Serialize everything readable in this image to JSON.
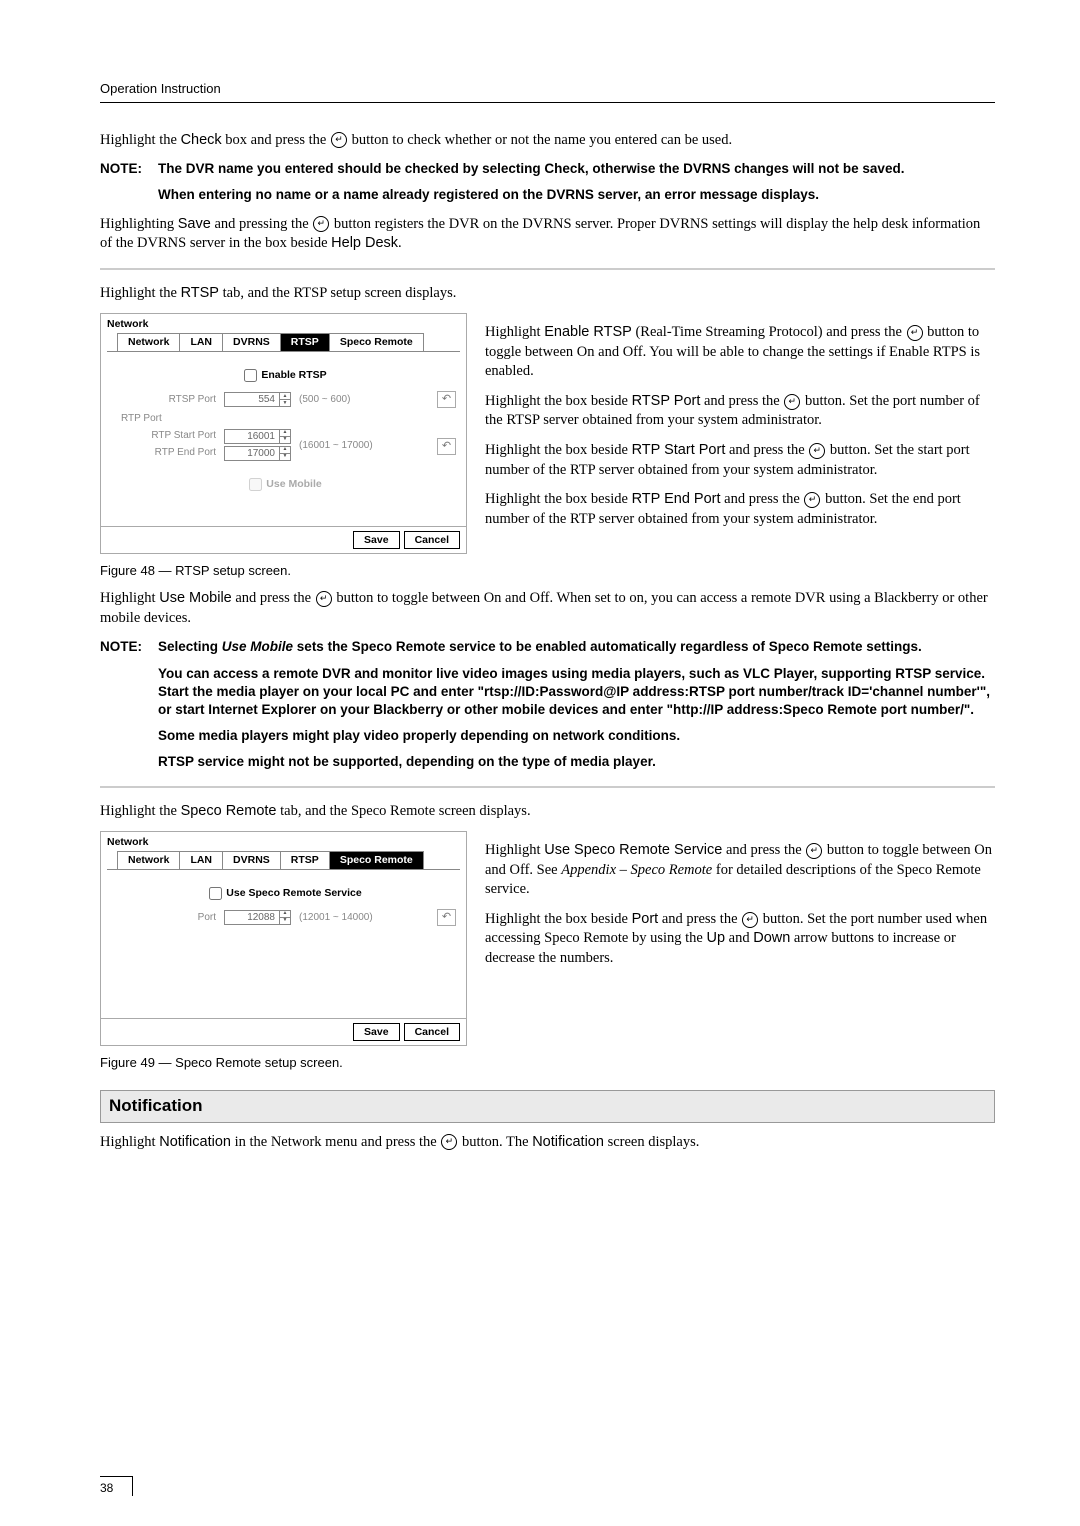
{
  "header": "Operation Instruction",
  "p1_a": "Highlight the ",
  "p1_b": "Check",
  "p1_c": " box and press the ",
  "p1_d": " button to check whether or not the name you entered can be used.",
  "note1_label": "NOTE:",
  "note1_text": "The DVR name you entered should be checked by selecting Check, otherwise the DVRNS changes will not be saved.",
  "note1b": "When entering no name or a name already registered on the DVRNS server, an error message displays.",
  "p2_a": "Highlighting ",
  "p2_b": "Save",
  "p2_c": " and pressing the ",
  "p2_d": " button registers the DVR on the DVRNS server.  Proper DVRNS settings will display the help desk information of the DVRNS server in the box beside ",
  "p2_e": "Help Desk",
  "p2_f": ".",
  "p3_a": "Highlight the ",
  "p3_b": "RTSP",
  "p3_c": " tab, and the RTSP setup screen displays.",
  "panel1": {
    "title": "Network",
    "tabs": {
      "network": "Network",
      "lan": "LAN",
      "dvrns": "DVRNS",
      "rtsp": "RTSP",
      "speco": "Speco Remote"
    },
    "enable_rtsp": "Enable RTSP",
    "rtp_port_section": "RTP Port",
    "rtsp_port_label": "RTSP Port",
    "rtsp_port_val": "554",
    "rtsp_port_range": "(500 ~ 600)",
    "rtp_start_label": "RTP Start Port",
    "rtp_start_val": "16001",
    "rtp_range": "(16001 ~ 17000)",
    "rtp_end_label": "RTP End Port",
    "rtp_end_val": "17000",
    "use_mobile": "Use Mobile",
    "save": "Save",
    "cancel": "Cancel"
  },
  "fig48": "Figure 48 — RTSP setup screen.",
  "rtsp_r1_a": "Highlight ",
  "rtsp_r1_b": "Enable RTSP",
  "rtsp_r1_c": " (Real-Time Streaming Protocol) and press the ",
  "rtsp_r1_d": " button to toggle between On and Off.  You will be able to change the settings if Enable RTPS is enabled.",
  "rtsp_r2_a": "Highlight the box beside ",
  "rtsp_r2_b": "RTSP Port",
  "rtsp_r2_c": " and press the ",
  "rtsp_r2_d": " button. Set the port number of the RTSP server obtained from your system administrator.",
  "rtsp_r3_a": "Highlight the box beside ",
  "rtsp_r3_b": "RTP Start Port",
  "rtsp_r3_c": " and press the ",
  "rtsp_r3_d": " button.  Set the start port number of the RTP server obtained from your system administrator.",
  "rtsp_r4_a": "Highlight the box beside ",
  "rtsp_r4_b": "RTP End Port",
  "rtsp_r4_c": " and press the ",
  "rtsp_r4_d": " button.  Set the end port number of the RTP server obtained from your system administrator.",
  "p4_a": "Highlight ",
  "p4_b": "Use Mobile",
  "p4_c": " and press the ",
  "p4_d": " button to toggle between On and Off.  When set to on, you can access a remote DVR using a Blackberry or other mobile devices.",
  "note2_label": "NOTE:",
  "note2_text_a": "Selecting ",
  "note2_text_b": "Use Mobile",
  "note2_text_c": " sets the Speco Remote service to be enabled automatically regardless of Speco Remote settings.",
  "note2b": "You can access a remote DVR and monitor live video images using media players, such as VLC Player, supporting RTSP service.  Start the media player on your local PC and enter \"rtsp://ID:Password@IP address:RTSP port number/track ID='channel number'\", or start Internet Explorer on your Blackberry or other mobile devices and enter \"http://IP address:Speco Remote port number/\".",
  "note2c": "Some media players might play video properly depending on network conditions.",
  "note2d": "RTSP service might not be supported, depending on the type of media player.",
  "p5_a": "Highlight the ",
  "p5_b": "Speco Remote",
  "p5_c": " tab, and the Speco Remote screen displays.",
  "panel2": {
    "title": "Network",
    "tabs": {
      "network": "Network",
      "lan": "LAN",
      "dvrns": "DVRNS",
      "rtsp": "RTSP",
      "speco": "Speco Remote"
    },
    "use_service": "Use Speco Remote Service",
    "port_label": "Port",
    "port_val": "12088",
    "port_range": "(12001 ~ 14000)",
    "save": "Save",
    "cancel": "Cancel"
  },
  "fig49": "Figure 49 — Speco Remote setup screen.",
  "speco_r1_a": "Highlight ",
  "speco_r1_b": "Use Speco Remote Service",
  "speco_r1_c": " and press the ",
  "speco_r1_d": " button to toggle between On and Off.  See ",
  "speco_r1_e": "Appendix – Speco Remote",
  "speco_r1_f": " for detailed descriptions of the Speco Remote service.",
  "speco_r2_a": "Highlight the box beside ",
  "speco_r2_b": "Port",
  "speco_r2_c": " and press the ",
  "speco_r2_d": " button.  Set the port number used when accessing Speco Remote by using the ",
  "speco_r2_e": "Up",
  "speco_r2_f": " and ",
  "speco_r2_g": "Down",
  "speco_r2_h": " arrow buttons to increase or decrease the numbers.",
  "section_notification": "Notification",
  "p6_a": "Highlight ",
  "p6_b": "Notification",
  "p6_c": " in the Network menu and press the ",
  "p6_d": " button.  The ",
  "p6_e": "Notification",
  "p6_f": " screen displays.",
  "page_num": "38"
}
